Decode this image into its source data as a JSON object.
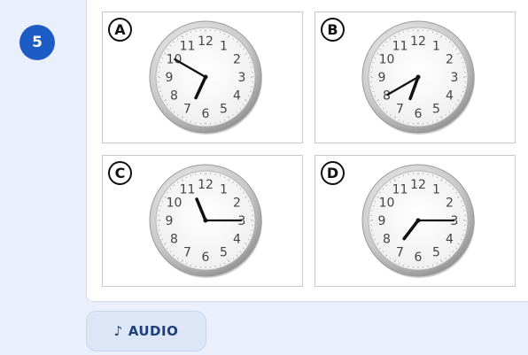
{
  "question": {
    "number": "5"
  },
  "options": [
    {
      "letter": "A",
      "hour": 6.83,
      "minute": 50
    },
    {
      "letter": "B",
      "hour": 6.67,
      "minute": 40
    },
    {
      "letter": "C",
      "hour": 11.25,
      "minute": 15
    },
    {
      "letter": "D",
      "hour": 7.25,
      "minute": 15
    }
  ],
  "clock_numerals": [
    "12",
    "1",
    "2",
    "3",
    "4",
    "5",
    "6",
    "7",
    "8",
    "9",
    "10",
    "11"
  ],
  "audio_button": {
    "icon": "music-note-icon",
    "glyph": "♪",
    "label": "AUDIO"
  },
  "colors": {
    "accent": "#1d5cc4",
    "audio_bg": "#dce6f6",
    "audio_text": "#1f3f7a"
  }
}
